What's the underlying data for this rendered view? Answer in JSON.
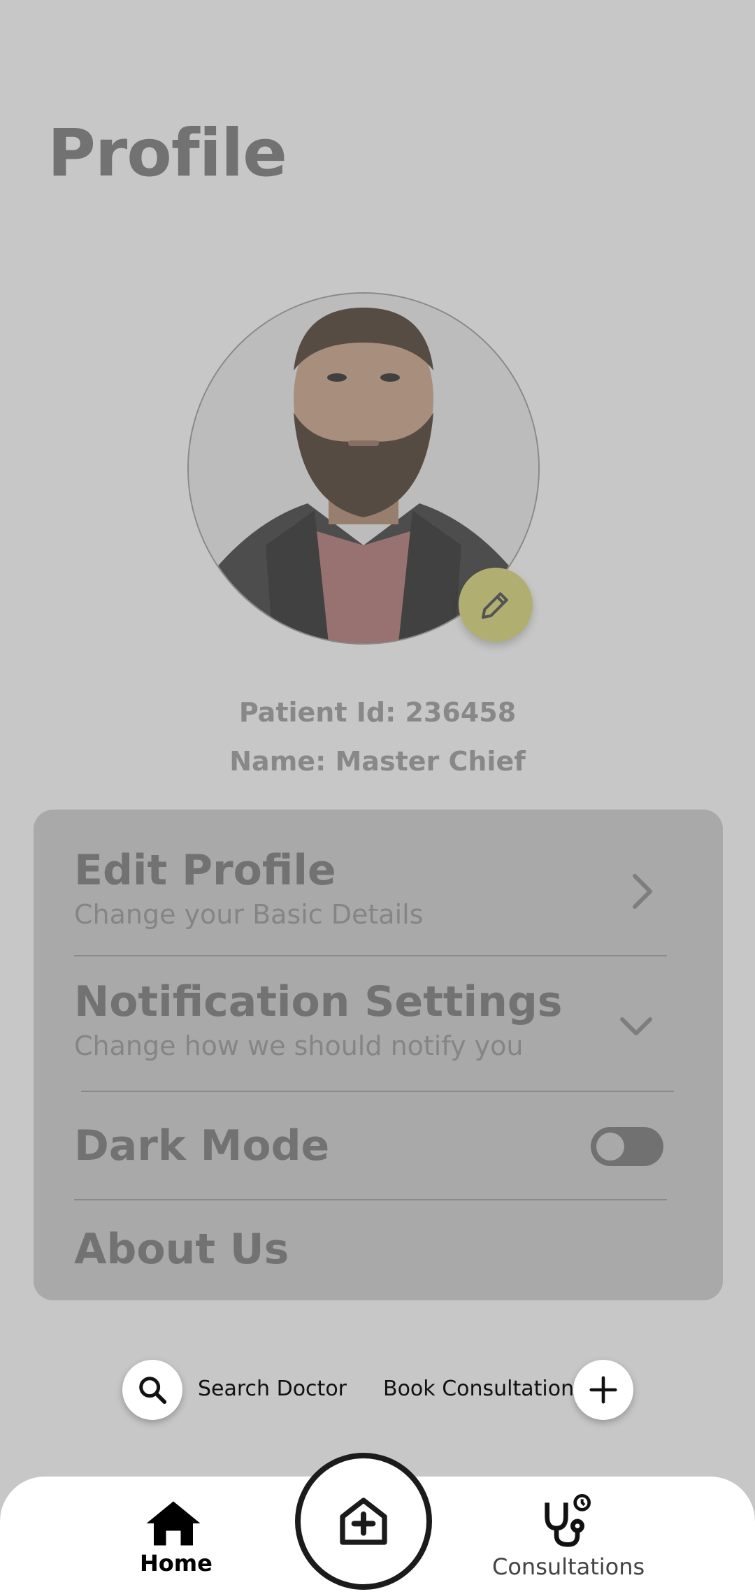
{
  "page": {
    "title": "Profile"
  },
  "profile": {
    "patient_id_text": "Patient Id: 236458",
    "name_text": "Name: Master Chief"
  },
  "settings": [
    {
      "title": "Edit Profile",
      "subtitle": "Change your Basic Details"
    },
    {
      "title": "Notification Settings",
      "subtitle": "Change how we should notify you"
    },
    {
      "title": "Dark Mode"
    },
    {
      "title": "About Us"
    }
  ],
  "dark_mode": {
    "enabled": false
  },
  "quick_actions": {
    "search_label": "Search Doctor",
    "book_label": "Book Consultation"
  },
  "bottom_nav": {
    "home_label": "Home",
    "consultations_label": "Consultations"
  },
  "icons": [
    "edit-pencil-icon",
    "chevron-right-icon",
    "chevron-down-icon",
    "search-icon",
    "plus-icon",
    "home-icon",
    "hospital-plus-icon",
    "stethoscope-icon"
  ],
  "colors": {
    "edit_button": "#d8d58a",
    "overlay": "rgba(0,0,0,0.18)"
  }
}
